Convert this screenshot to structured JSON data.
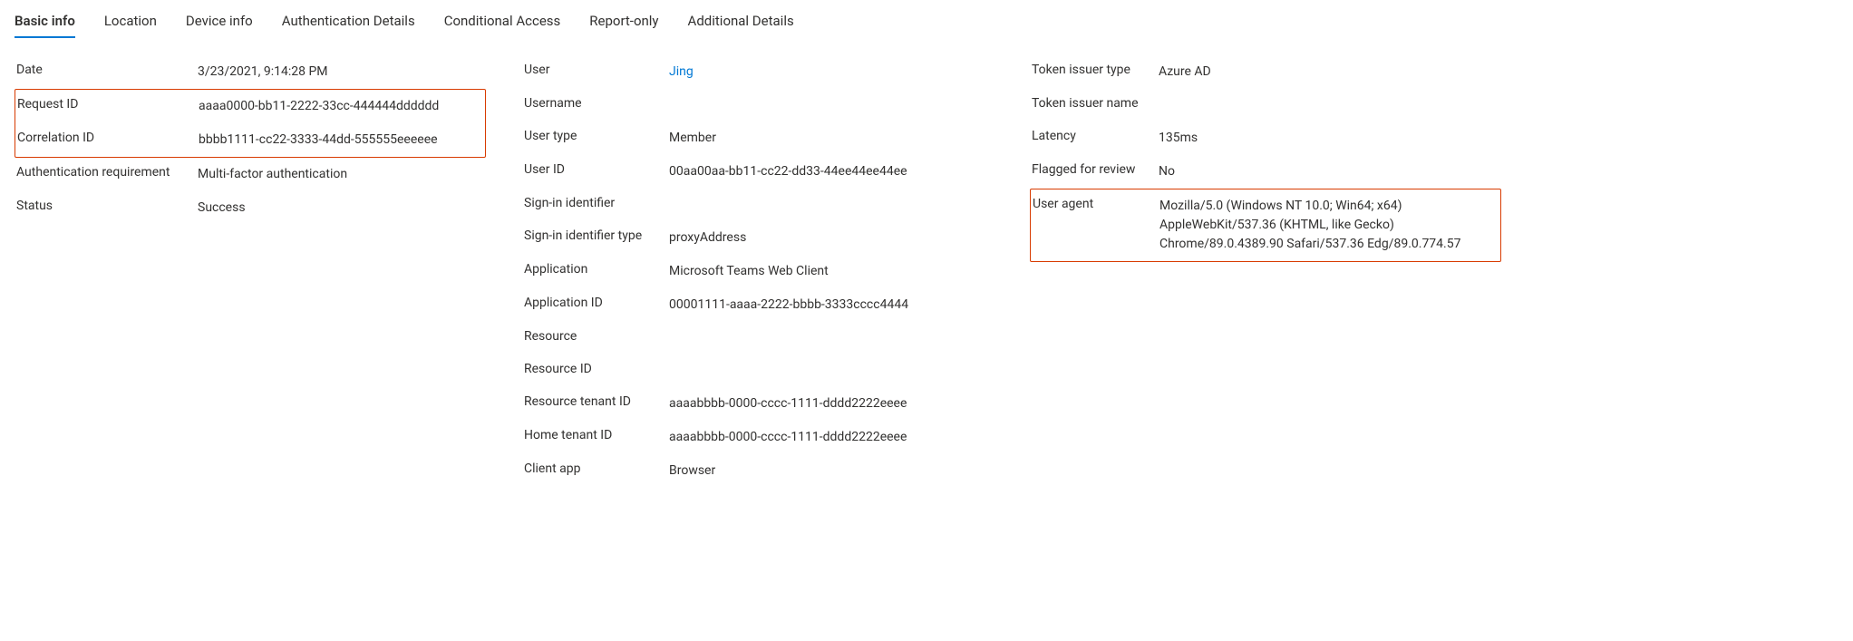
{
  "tabs": [
    {
      "label": "Basic info",
      "active": true
    },
    {
      "label": "Location",
      "active": false
    },
    {
      "label": "Device info",
      "active": false
    },
    {
      "label": "Authentication Details",
      "active": false
    },
    {
      "label": "Conditional Access",
      "active": false
    },
    {
      "label": "Report-only",
      "active": false
    },
    {
      "label": "Additional Details",
      "active": false
    }
  ],
  "col1": {
    "date": {
      "label": "Date",
      "value": "3/23/2021, 9:14:28 PM"
    },
    "request_id": {
      "label": "Request ID",
      "value": "aaaa0000-bb11-2222-33cc-444444dddddd"
    },
    "correlation_id": {
      "label": "Correlation ID",
      "value": "bbbb1111-cc22-3333-44dd-555555eeeeee"
    },
    "auth_requirement": {
      "label": "Authentication requirement",
      "value": "Multi-factor authentication"
    },
    "status": {
      "label": "Status",
      "value": "Success"
    }
  },
  "col2": {
    "user": {
      "label": "User",
      "value": "Jing"
    },
    "username": {
      "label": "Username",
      "value": ""
    },
    "user_type": {
      "label": "User type",
      "value": "Member"
    },
    "user_id": {
      "label": "User ID",
      "value": "00aa00aa-bb11-cc22-dd33-44ee44ee44ee"
    },
    "sign_in_identifier": {
      "label": "Sign-in identifier",
      "value": ""
    },
    "sign_in_identifier_type": {
      "label": "Sign-in identifier type",
      "value": "proxyAddress"
    },
    "application": {
      "label": "Application",
      "value": "Microsoft Teams Web Client"
    },
    "application_id": {
      "label": "Application ID",
      "value": "00001111-aaaa-2222-bbbb-3333cccc4444"
    },
    "resource": {
      "label": "Resource",
      "value": ""
    },
    "resource_id": {
      "label": "Resource ID",
      "value": ""
    },
    "resource_tenant_id": {
      "label": "Resource tenant ID",
      "value": "aaaabbbb-0000-cccc-1111-dddd2222eeee"
    },
    "home_tenant_id": {
      "label": "Home tenant ID",
      "value": "aaaabbbb-0000-cccc-1111-dddd2222eeee"
    },
    "client_app": {
      "label": "Client app",
      "value": "Browser"
    }
  },
  "col3": {
    "token_issuer_type": {
      "label": "Token issuer type",
      "value": "Azure AD"
    },
    "token_issuer_name": {
      "label": "Token issuer name",
      "value": ""
    },
    "latency": {
      "label": "Latency",
      "value": "135ms"
    },
    "flagged_for_review": {
      "label": "Flagged for review",
      "value": "No"
    },
    "user_agent": {
      "label": "User agent",
      "value": "Mozilla/5.0 (Windows NT 10.0; Win64; x64) AppleWebKit/537.36 (KHTML, like Gecko) Chrome/89.0.4389.90 Safari/537.36 Edg/89.0.774.57"
    }
  }
}
